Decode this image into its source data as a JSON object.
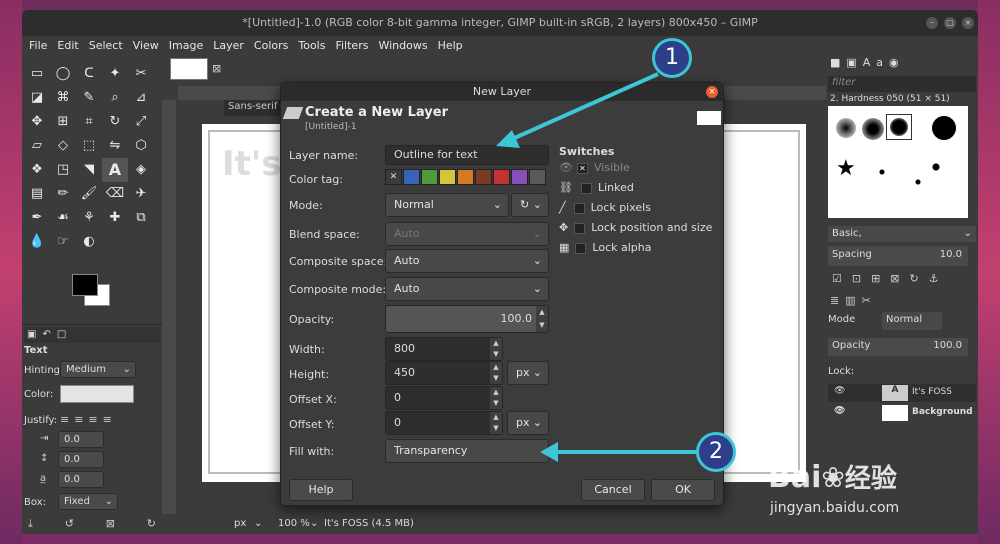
{
  "window": {
    "title": "*[Untitled]-1.0 (RGB color 8-bit gamma integer, GIMP built-in sRGB, 2 layers) 800x450 – GIMP"
  },
  "menu": [
    "File",
    "Edit",
    "Select",
    "View",
    "Image",
    "Layer",
    "Colors",
    "Tools",
    "Filters",
    "Windows",
    "Help"
  ],
  "toolbox": {
    "text_title": "Text",
    "hinting_label": "Hinting:",
    "hinting_value": "Medium",
    "color_label": "Color:",
    "justify_label": "Justify:",
    "box_label": "Box:",
    "box_value": "Fixed",
    "spin1": "0.0",
    "spin2": "0.0",
    "spin3": "0.0"
  },
  "canvas": {
    "font_field": "Sans-serif",
    "canvas_text": "It's"
  },
  "status": {
    "unit": "px",
    "zoom": "100 %",
    "info": "It's FOSS (4.5 MB)"
  },
  "right_panel": {
    "filter_placeholder": "filter",
    "brush_name": "2. Hardness 050 (51 × 51)",
    "preset": "Basic,",
    "spacing_label": "Spacing",
    "spacing_value": "10.0",
    "mode_label": "Mode",
    "mode_value": "Normal",
    "opacity_label": "Opacity",
    "opacity_value": "100.0",
    "lock_label": "Lock:",
    "layers": [
      {
        "name": "It's FOSS"
      },
      {
        "name": "Background"
      }
    ]
  },
  "dialog": {
    "title": "New Layer",
    "heading": "Create a New Layer",
    "subheading": "[Untitled]-1",
    "fields": {
      "layer_name_label": "Layer name:",
      "layer_name_value": "Outline for text",
      "color_tag_label": "Color tag:",
      "mode_label": "Mode:",
      "mode_value": "Normal",
      "blend_label": "Blend space:",
      "blend_value": "Auto",
      "composite_space_label": "Composite space:",
      "composite_space_value": "Auto",
      "composite_mode_label": "Composite mode:",
      "composite_mode_value": "Auto",
      "opacity_label": "Opacity:",
      "opacity_value": "100.0",
      "width_label": "Width:",
      "width_value": "800",
      "height_label": "Height:",
      "height_value": "450",
      "unit": "px",
      "offset_x_label": "Offset X:",
      "offset_x_value": "0",
      "offset_y_label": "Offset Y:",
      "offset_y_value": "0",
      "unit2": "px",
      "fill_label": "Fill with:",
      "fill_value": "Transparency"
    },
    "switches": {
      "title": "Switches",
      "visible": "Visible",
      "linked": "Linked",
      "lock_pixels": "Lock pixels",
      "lock_position": "Lock position and size",
      "lock_alpha": "Lock alpha"
    },
    "buttons": {
      "help": "Help",
      "cancel": "Cancel",
      "ok": "OK"
    },
    "color_tags": [
      "#3a3a3a",
      "#3764b8",
      "#4f9a3a",
      "#d6c53a",
      "#d47a22",
      "#7a3a26",
      "#c23434",
      "#8650b8",
      "#5a5a5a"
    ]
  },
  "callouts": {
    "one": "1",
    "two": "2"
  },
  "watermark": {
    "brand": "Bai",
    "brand2": "百度",
    "cn": "经验",
    "url": "jingyan.baidu.com"
  }
}
